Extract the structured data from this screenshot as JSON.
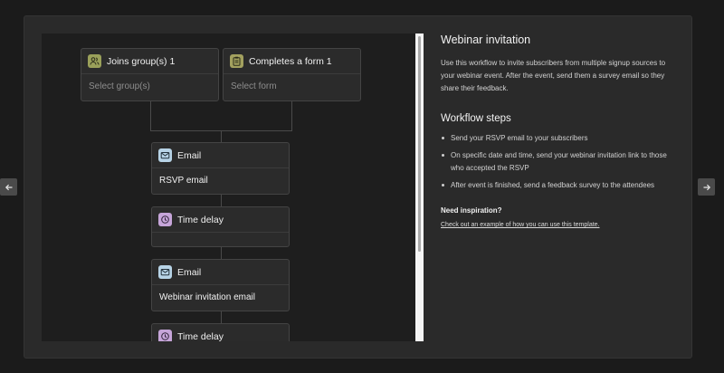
{
  "workflow": {
    "triggers": [
      {
        "title": "Joins group(s) 1",
        "placeholder": "Select group(s)",
        "icon": "users-icon"
      },
      {
        "title": "Completes a form 1",
        "placeholder": "Select form",
        "icon": "form-icon"
      }
    ],
    "steps": [
      {
        "type": "Email",
        "detail": "RSVP email",
        "icon": "envelope-icon"
      },
      {
        "type": "Time delay",
        "detail": "",
        "icon": "clock-icon"
      },
      {
        "type": "Email",
        "detail": "Webinar invitation email",
        "icon": "envelope-icon"
      },
      {
        "type": "Time delay",
        "detail": "",
        "icon": "clock-icon"
      }
    ]
  },
  "panel": {
    "title": "Webinar invitation",
    "description": "Use this workflow to invite subscribers from multiple signup sources to your webinar event. After the event, send them a survey email so they share their feedback.",
    "steps_heading": "Workflow steps",
    "steps": [
      "Send your RSVP email to your subscribers",
      "On specific date and time, send your webinar invitation link to those who accepted the RSVP",
      "After event is finished, send a feedback survey to the attendees"
    ],
    "inspiration_title": "Need inspiration?",
    "inspiration_link": "Check out an example of how you can use this template."
  },
  "colors": {
    "background": "#1b1b1b",
    "modal": "#2a2a2a",
    "canvas": "#1e1e1e",
    "trigger_icon": "#9aa05a",
    "email_icon": "#b7d3e6",
    "delay_icon": "#c6a5d9"
  }
}
